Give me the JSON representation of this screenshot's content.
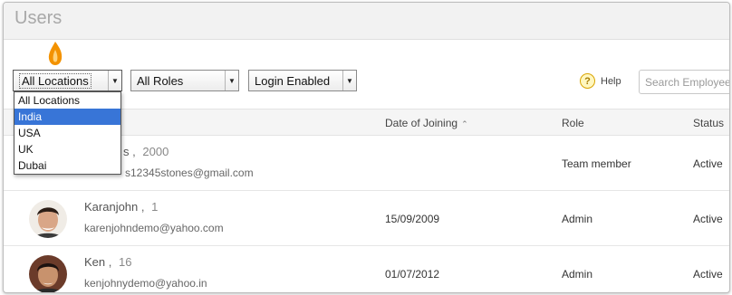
{
  "page": {
    "title": "Users"
  },
  "filters": {
    "location": {
      "selected": "All Locations",
      "options": [
        "All Locations",
        "India",
        "USA",
        "UK",
        "Dubai"
      ],
      "highlighted": "India"
    },
    "role": {
      "selected": "All Roles"
    },
    "login": {
      "selected": "Login Enabled"
    }
  },
  "help": {
    "label": "Help",
    "icon": "question-mark-icon"
  },
  "search": {
    "placeholder": "Search Employee"
  },
  "table": {
    "headers": {
      "date": "Date of Joining",
      "role": "Role",
      "status": "Status"
    },
    "rows": [
      {
        "name": "s",
        "sep": ",",
        "id": "2000",
        "email": "s12345stones@gmail.com",
        "date": "",
        "role": "Team member",
        "status": "Active"
      },
      {
        "name": "Karanjohn",
        "sep": ",",
        "id": "1",
        "email": "karenjohndemo@yahoo.com",
        "date": "15/09/2009",
        "role": "Admin",
        "status": "Active"
      },
      {
        "name": "Ken",
        "sep": ",",
        "id": "16",
        "email": "kenjohnydemo@yahoo.in",
        "date": "01/07/2012",
        "role": "Admin",
        "status": "Active"
      }
    ]
  },
  "colors": {
    "highlight": "#3875d7",
    "help_icon": "#d9a400",
    "flame": "#f39200"
  }
}
